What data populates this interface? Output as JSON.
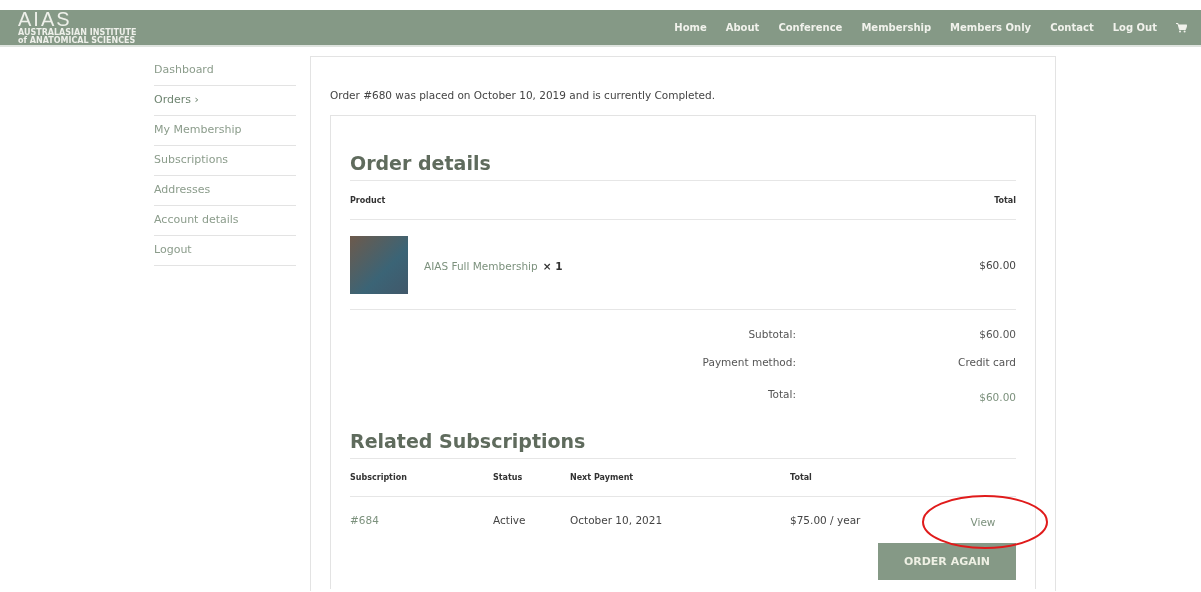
{
  "header": {
    "logo": {
      "mark": "AIAS",
      "subtitle_line_1": "AUSTRALASIAN INSTITUTE",
      "subtitle_line_2": "of ANATOMICAL SCIENCES"
    },
    "nav": [
      {
        "label": "Home"
      },
      {
        "label": "About"
      },
      {
        "label": "Conference"
      },
      {
        "label": "Membership"
      },
      {
        "label": "Members Only"
      },
      {
        "label": "Contact"
      },
      {
        "label": "Log Out"
      }
    ]
  },
  "sidebar": {
    "items": [
      {
        "label": "Dashboard",
        "selected": false
      },
      {
        "label": "Orders ›",
        "selected": true
      },
      {
        "label": "My Membership",
        "selected": false
      },
      {
        "label": "Subscriptions",
        "selected": false
      },
      {
        "label": "Addresses",
        "selected": false
      },
      {
        "label": "Account details",
        "selected": false
      },
      {
        "label": "Logout",
        "selected": false
      }
    ]
  },
  "order": {
    "summary": "Order #680 was placed on October 10, 2019 and is currently Completed.",
    "details_title": "Order details",
    "columns": [
      "Product",
      "Total"
    ],
    "items": [
      {
        "name": "AIAS Full Membership",
        "quantity": "× 1",
        "total": "$60.00"
      }
    ],
    "totals": [
      {
        "label": "Subtotal:",
        "value": "$60.00",
        "kind": "plain"
      },
      {
        "label": "Payment method:",
        "value": "Credit card",
        "kind": "plain"
      },
      {
        "label": "Total:",
        "value": "$60.00",
        "kind": "grand"
      }
    ]
  },
  "subscriptions": {
    "title": "Related Subscriptions",
    "columns": [
      "Subscription",
      "Status",
      "Next Payment",
      "Total"
    ],
    "rows": [
      {
        "id": "#684",
        "status": "Active",
        "next_payment": "October 10, 2021",
        "total": "$75.00 / year",
        "action": "View",
        "highlighted": true
      }
    ],
    "order_again": "ORDER AGAIN"
  }
}
